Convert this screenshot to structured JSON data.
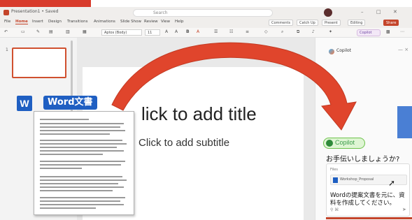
{
  "colors": {
    "accent": "#c4442a",
    "word_blue": "#1f5fc2",
    "copilot_green": "#6cc24a",
    "arrow_red": "#e0452c"
  },
  "window": {
    "filename": "Presentation1 • Saved",
    "search_placeholder": "Search",
    "controls": [
      "–",
      "□",
      "✕"
    ]
  },
  "menu": {
    "tabs": [
      "File",
      "Home",
      "Insert",
      "Design",
      "Transitions",
      "Animations",
      "Slide Show",
      "Review",
      "View",
      "Help"
    ],
    "active_tab": "Home",
    "right_buttons": [
      "Comments",
      "Catch Up",
      "Present",
      "Editing",
      "Share"
    ]
  },
  "ribbon": {
    "font_name": "Aptos (Body)",
    "font_size": "11",
    "copilot_label": "Copilot"
  },
  "thumbnails": {
    "slide_number": "1"
  },
  "slide": {
    "title_placeholder": "lick to add title",
    "subtitle_placeholder": "Click to add subtitle"
  },
  "word_badge": {
    "icon_letter": "W",
    "label": "Word文書"
  },
  "copilot": {
    "header_title": "Copilot",
    "pill_label": "Copilot",
    "greeting": "お手伝いしましょうか?",
    "attachment_label": "Files",
    "attachment_name": "Workshop_Proposal",
    "prompt": "Wordの提案文書を元に、資料を作成してください。",
    "close": "— ×"
  }
}
